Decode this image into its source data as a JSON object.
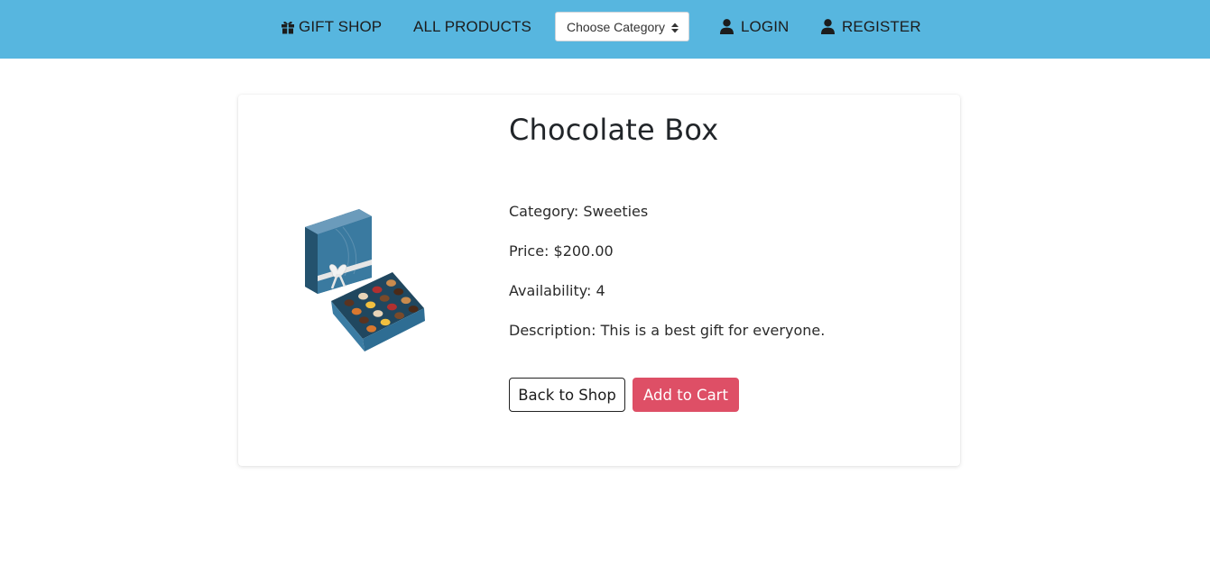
{
  "navbar": {
    "brand_label": "GIFT SHOP",
    "brand_icon": "gift-icon",
    "all_products_label": "ALL PRODUCTS",
    "category_select": {
      "selected": "Choose Category"
    },
    "login_label": "LOGIN",
    "register_label": "REGISTER",
    "user_icon": "user-icon",
    "background_color": "#57b6df"
  },
  "product": {
    "title": "Chocolate Box",
    "category": "Category: Sweeties",
    "price": "Price: $200.00",
    "availability": "Availability: 4",
    "description": "Description: This is a best gift for everyone.",
    "image_alt": "Chocolate box product image"
  },
  "actions": {
    "back_label": "Back to Shop",
    "add_to_cart_label": "Add to Cart",
    "add_to_cart_color": "#de4f66"
  }
}
